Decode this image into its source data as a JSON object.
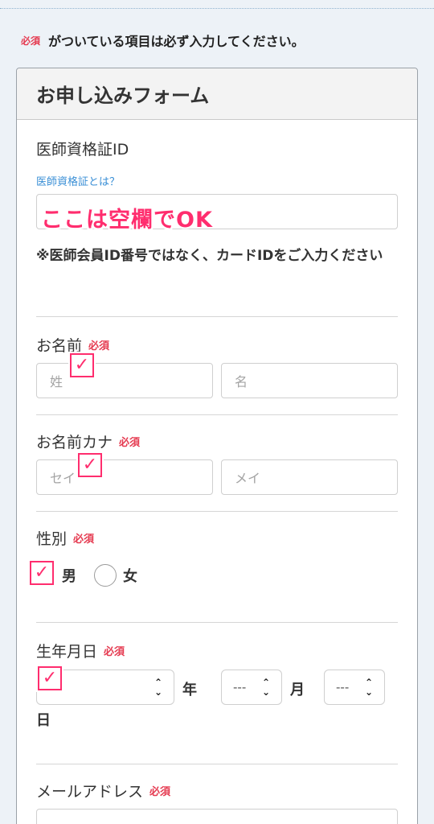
{
  "notice": {
    "badge": "必須",
    "text": "がついている項目は必ず入力してください。"
  },
  "form": {
    "title": "お申し込みフォーム",
    "license": {
      "label": "医師資格証ID",
      "link": "医師資格証とは？",
      "overlay": "ここは空欄でOK",
      "note": "※医師会員ID番号ではなく、カードIDをご入力ください"
    },
    "name": {
      "label": "お名前",
      "badge": "必須",
      "last_placeholder": "姓",
      "first_placeholder": "名"
    },
    "kana": {
      "label": "お名前カナ",
      "badge": "必須",
      "last_placeholder": "セイ",
      "first_placeholder": "メイ"
    },
    "gender": {
      "label": "性別",
      "badge": "必須",
      "options": [
        "男",
        "女"
      ]
    },
    "birthday": {
      "label": "生年月日",
      "badge": "必須",
      "month_value": "---",
      "day_value": "---",
      "year_unit": "年",
      "month_unit": "月",
      "day_unit": "日"
    },
    "email": {
      "label": "メールアドレス",
      "badge": "必須"
    }
  },
  "annotation": {
    "check_symbol": "✓",
    "color": "#ff2d6e"
  }
}
